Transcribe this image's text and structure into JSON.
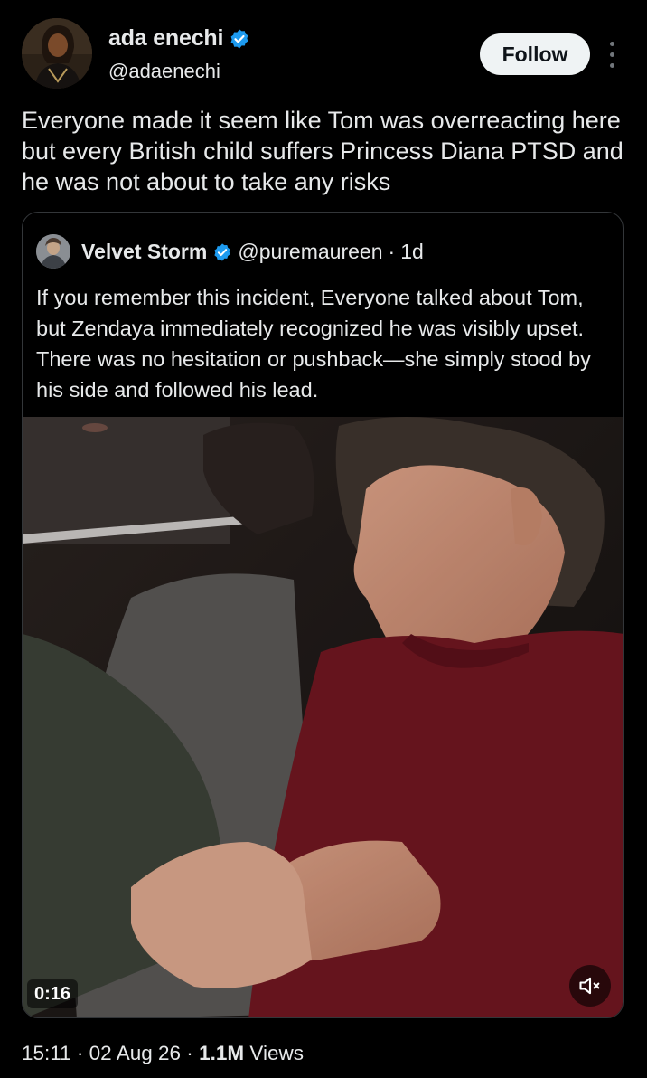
{
  "author": {
    "name": "ada enechi",
    "handle": "@adaenechi",
    "verified": true
  },
  "actions": {
    "follow_label": "Follow"
  },
  "tweet": {
    "text": "Everyone made it seem like Tom was overreacting here but every British child suffers Princess Diana PTSD and he was not about to take any risks"
  },
  "quoted": {
    "name": "Velvet Storm",
    "handle": "@puremaureen",
    "separator": "·",
    "age": "1d",
    "verified": true,
    "text": "If you remember this incident, Everyone talked about Tom, but  Zendaya immediately recognized he was visibly upset. There was no hesitation or pushback—she simply stood by his side and followed his lead.",
    "video": {
      "duration": "0:16",
      "muted": true
    }
  },
  "meta": {
    "time": "15:11",
    "sep1": "·",
    "date": "02 Aug 26",
    "sep2": "·",
    "views_count": "1.1M",
    "views_label": "Views"
  },
  "colors": {
    "background": "#000000",
    "text": "#e7e9ea",
    "verified_badge": "#1d9bf0",
    "follow_bg": "#eff3f4",
    "border": "#333639",
    "shirt": "#6e1620"
  },
  "icons": [
    "verified-badge-icon",
    "more-options-icon",
    "mute-icon"
  ]
}
